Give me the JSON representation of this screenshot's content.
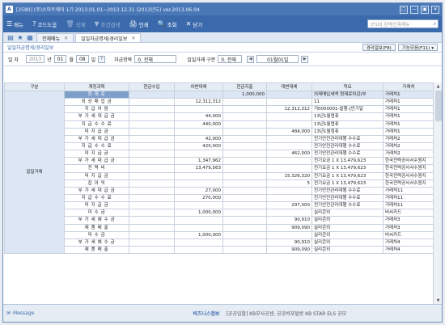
{
  "window": {
    "app_icon": "A",
    "title": "[2580] (주)소마트웨어   1기   2013.01.01~2013.12.31  (2013년도)   ver.2013.06.04",
    "controls": [
      "□",
      "—",
      "▣",
      "✕"
    ]
  },
  "toolbar": {
    "items": [
      {
        "icon": "☰",
        "label": "메뉴",
        "enabled": true
      },
      {
        "icon": "?",
        "label": "코드도움",
        "enabled": true
      },
      {
        "icon": "🗑",
        "label": "삭제",
        "enabled": false
      },
      {
        "icon": "▼",
        "label": "조건검색",
        "enabled": false
      },
      {
        "icon": "🖨",
        "label": "인쇄",
        "enabled": true
      },
      {
        "icon": "🔍",
        "label": "조회",
        "enabled": true
      },
      {
        "icon": "✕",
        "label": "닫기",
        "enabled": true
      }
    ],
    "search_placeholder": "[F10] 검색/단축메뉴",
    "search_icon": "⌕"
  },
  "tabs": [
    {
      "label": "전체메뉴",
      "active": false
    },
    {
      "label": "일일자금명세/경리일보",
      "active": true
    }
  ],
  "breadcrumb": "일일자금명세/경리일보",
  "header_buttons": [
    "경리일보(F8)",
    "기능모음(F11) ▾"
  ],
  "filter": {
    "date_label": "일 자",
    "year": "2013",
    "year_unit": "년",
    "month": "01",
    "month_unit": "월",
    "day": "08",
    "day_unit": "일",
    "help": "?",
    "subject_label": "자금항목",
    "subject_value": "0. 전체",
    "daily_label": "일일거래 구분",
    "daily_value": "0. 전체",
    "prev": "◀",
    "period_value": "01월01일",
    "next": "▶"
  },
  "table": {
    "headers": [
      "구분",
      "계정과목",
      "현금수입",
      "차변대체",
      "현금지출",
      "대변대체",
      "적요",
      "거래처"
    ],
    "group_label": "일일거래",
    "rows": [
      [
        "현 재 료",
        "",
        "",
        "1,000,000",
        "",
        "의제매입세액 원재료차감(부",
        "거래처1"
      ],
      [
        "외 상 매 입 금",
        "",
        "12,312,312",
        "",
        "",
        "11",
        "거래처1"
      ],
      [
        "지 급 어 음",
        "",
        "",
        "",
        "12,312,312",
        "거0000001-발행-[만기일",
        "거래처1"
      ],
      [
        "부 가 세 대 급 금",
        "",
        "44,000",
        "",
        "",
        "13년1월컴퓨",
        "거래처1"
      ],
      [
        "지 급 수 수 료",
        "",
        "440,000",
        "",
        "",
        "13년1월컴퓨",
        "거래처1"
      ],
      [
        "미 지 급 금",
        "",
        "",
        "",
        "484,000",
        "13년1월컴퓨",
        "거래처1"
      ],
      [
        "부 가 세 대 급 금",
        "",
        "42,000",
        "",
        "",
        "전기안전관리대행 수수료",
        "거래처2"
      ],
      [
        "지 급 수 수 료",
        "",
        "420,000",
        "",
        "",
        "전기안전관리대행 수수료",
        "거래처2"
      ],
      [
        "미 지 급 금",
        "",
        "",
        "",
        "462,000",
        "전기안전관리대행 수수료",
        "거래처2"
      ],
      [
        "부 가 세 대 급 금",
        "",
        "1,347,962",
        "",
        "",
        "전기요금 1 X 13,479,623",
        "한국전력공사서수원지"
      ],
      [
        "전 력 비",
        "",
        "13,479,563",
        "",
        "",
        "전기요금 1 X 13,479,623",
        "한국전력공사서수원지"
      ],
      [
        "미 지 급 금",
        "",
        "",
        "",
        "15,326,320",
        "전기요금 1 X 13,479,623",
        "한국전력공사서수원지"
      ],
      [
        "잡 이 익",
        "",
        "",
        "",
        "5",
        "전기요금 1 X 13,479,623",
        "한국전력공사서수원지"
      ],
      [
        "부 가 세 대 급 금",
        "",
        "27,000",
        "",
        "",
        "전기안전관리대행 수수료",
        "거래처11"
      ],
      [
        "지 급 수 수 료",
        "",
        "270,000",
        "",
        "",
        "전기안전관리대행 수수료",
        "거래처11"
      ],
      [
        "미 지 급 금",
        "",
        "",
        "",
        "297,000",
        "전기안전관리대행 수수료",
        "거래처11"
      ],
      [
        "미 수 금",
        "",
        "1,000,000",
        "",
        "",
        "실리콘외",
        "비씨카드"
      ],
      [
        "부 가 세 예 수 금",
        "",
        "",
        "",
        "90,910",
        "실리콘외",
        "거래처3"
      ],
      [
        "제 품 매 출",
        "",
        "",
        "",
        "909,090",
        "실리콘외",
        "거래처3"
      ],
      [
        "미 수 금",
        "",
        "1,000,000",
        "",
        "",
        "실리콘외",
        "비씨카드"
      ],
      [
        "부 가 세 예 수 금",
        "",
        "",
        "",
        "90,910",
        "실리콘외",
        "거래처4"
      ],
      [
        "제 품 매 출",
        "",
        "",
        "",
        "909,090",
        "실리콘외",
        "거래처4"
      ]
    ],
    "selected_row": 0
  },
  "status": {
    "message_icon": "✉",
    "message_label": "Message",
    "biz_label": "비즈니스정보",
    "biz_value": "[공공입찰] KB부사공센, 공공비포털방 KB STAR ELS 공모"
  },
  "scroll": {
    "up": "▲",
    "down": "▼"
  }
}
